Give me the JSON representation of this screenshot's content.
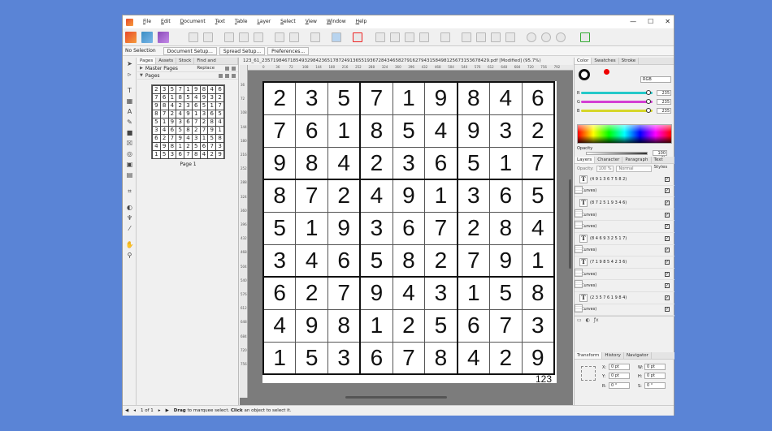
{
  "menu": [
    "File",
    "Edit",
    "Document",
    "Text",
    "Table",
    "Layer",
    "Select",
    "View",
    "Window",
    "Help"
  ],
  "window_controls": {
    "minimize": "—",
    "maximize": "☐",
    "close": "✕"
  },
  "context_toolbar": {
    "selection": "No Selection",
    "buttons": [
      "Document Setup...",
      "Spread Setup...",
      "Preferences..."
    ]
  },
  "pages_panel": {
    "tabs": [
      "Pages",
      "Assets",
      "Stock",
      "Find and Replace"
    ],
    "master_pages": "Master Pages",
    "pages": "Pages",
    "page_label": "Page 1"
  },
  "document_title": "123_61_23571984671854932984236517872491365519367284346582791627943158498125673153678429.pdf [Modified] (95.7%)",
  "ruler_h": [
    "0",
    "36",
    "72",
    "108",
    "144",
    "180",
    "216",
    "252",
    "288",
    "324",
    "360",
    "396",
    "432",
    "468",
    "504",
    "540",
    "576",
    "612",
    "648",
    "684",
    "720",
    "756",
    "792"
  ],
  "ruler_v": [
    "36",
    "72",
    "108",
    "144",
    "180",
    "216",
    "252",
    "288",
    "324",
    "360",
    "396",
    "432",
    "468",
    "504",
    "540",
    "576",
    "612",
    "648",
    "684",
    "720",
    "756"
  ],
  "sudoku": [
    [
      "2",
      "3",
      "5",
      "7",
      "1",
      "9",
      "8",
      "4",
      "6"
    ],
    [
      "7",
      "6",
      "1",
      "8",
      "5",
      "4",
      "9",
      "3",
      "2"
    ],
    [
      "9",
      "8",
      "4",
      "2",
      "3",
      "6",
      "5",
      "1",
      "7"
    ],
    [
      "8",
      "7",
      "2",
      "4",
      "9",
      "1",
      "3",
      "6",
      "5"
    ],
    [
      "5",
      "1",
      "9",
      "3",
      "6",
      "7",
      "2",
      "8",
      "4"
    ],
    [
      "3",
      "4",
      "6",
      "5",
      "8",
      "2",
      "7",
      "9",
      "1"
    ],
    [
      "6",
      "2",
      "7",
      "9",
      "4",
      "3",
      "1",
      "5",
      "8"
    ],
    [
      "4",
      "9",
      "8",
      "1",
      "2",
      "5",
      "6",
      "7",
      "3"
    ],
    [
      "1",
      "5",
      "3",
      "6",
      "7",
      "8",
      "4",
      "2",
      "9"
    ]
  ],
  "page_number": "123",
  "color_panel": {
    "tabs": [
      "Color",
      "Swatches",
      "Stroke"
    ],
    "model": "RGB",
    "r": "235",
    "g": "235",
    "b": "235",
    "r_label": "R",
    "g_label": "G",
    "b_label": "B",
    "opacity_label": "Opacity",
    "opacity": "100 %",
    "slider_colors": {
      "r": "#25c9c9",
      "g": "#d43fd4",
      "b": "#d6d629"
    }
  },
  "layers_panel": {
    "tabs": [
      "Layers",
      "Character",
      "Paragraph",
      "Text Styles"
    ],
    "opacity_label": "Opacity:",
    "opacity": "100 %",
    "blend": "Normal",
    "rows": [
      {
        "icon": "T",
        "label": "(4 9 1 3 6 7 5 8 2)"
      },
      {
        "icon": "grid",
        "label": "(Curves)"
      },
      {
        "icon": "T",
        "label": "(8 7 2 5 1 9 3 4 6)"
      },
      {
        "icon": "grid",
        "label": "(Curves)"
      },
      {
        "icon": "grid",
        "label": "(Curves)"
      },
      {
        "icon": "T",
        "label": "(8 4 6 9 3 2 5 1 7)"
      },
      {
        "icon": "grid",
        "label": "(Curves)"
      },
      {
        "icon": "T",
        "label": "(7 1 9 8 5 4 2 3 6)"
      },
      {
        "icon": "grid",
        "label": "(Curves)"
      },
      {
        "icon": "grid",
        "label": "(Curves)"
      },
      {
        "icon": "T",
        "label": "(2 3 5 7 6 1 9 8 4)"
      },
      {
        "icon": "grid",
        "label": "(Curves)"
      }
    ],
    "check": "✓"
  },
  "transform_panel": {
    "tabs": [
      "Transform",
      "History",
      "Navigator"
    ],
    "x_label": "X:",
    "y_label": "Y:",
    "w_label": "W:",
    "h_label": "H:",
    "r_label": "R:",
    "s_label": "S:",
    "x": "0 pt",
    "y": "0 pt",
    "w": "0 pt",
    "h": "0 pt",
    "r": "0 °",
    "s": "0 °"
  },
  "status_bar": {
    "page_count": "1 of 1",
    "hint_bold1": "Drag",
    "hint1": "to marquee select.",
    "hint_bold2": "Click",
    "hint2": "an object to select it."
  }
}
